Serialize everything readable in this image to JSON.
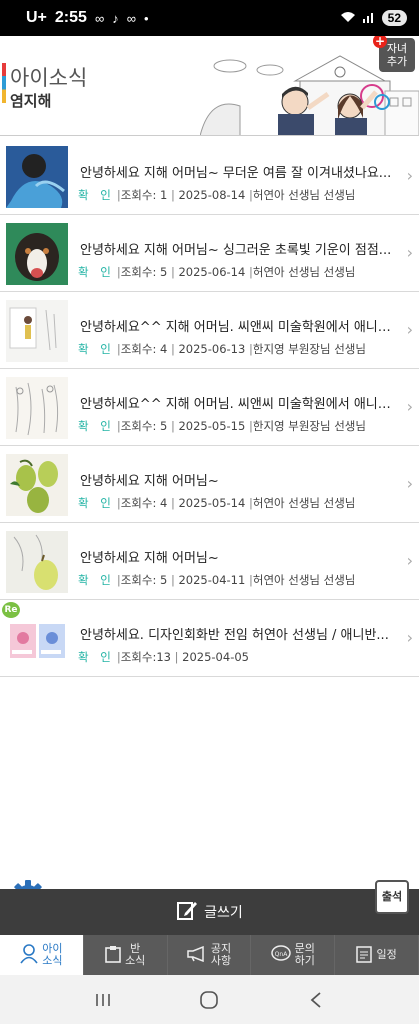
{
  "status_bar": {
    "carrier": "U+",
    "time": "2:55",
    "notification_icons": [
      "infinity-icon",
      "tiktok-icon",
      "infinity-icon",
      "dot-icon"
    ],
    "battery": "52"
  },
  "header": {
    "title": "아이소식",
    "student_name": "염지해",
    "add_child_label": "자녀\n추가"
  },
  "posts": [
    {
      "title": "안녕하세요 지해 어머님~ 무더운 여름 잘 이겨내셨나요...",
      "status": "확 인",
      "views": "조회수: 1",
      "date": "2025-08-14",
      "author": "허연아 선생님 선생님",
      "thumb": "blue-painting",
      "reply": false
    },
    {
      "title": "안녕하세요 지해 어머님~ 싱그러운 초록빛 기운이 점점...",
      "status": "확 인",
      "views": "조회수: 5",
      "date": "2025-06-14",
      "author": "허연아 선생님 선생님",
      "thumb": "dog-painting",
      "reply": false
    },
    {
      "title": "안녕하세요^^ 지해 어머님. 씨앤씨 미술학원에서 애니반...",
      "status": "확 인",
      "views": "조회수: 4",
      "date": "2025-06-13",
      "author": "한지영 부원장님 선생님",
      "thumb": "sketch-figure",
      "reply": false
    },
    {
      "title": "안녕하세요^^ 지해 어머님. 씨앤씨 미술학원에서 애니반...",
      "status": "확 인",
      "views": "조회수: 5",
      "date": "2025-05-15",
      "author": "한지영 부원장님 선생님",
      "thumb": "pencil-sketch",
      "reply": false
    },
    {
      "title": "안녕하세요 지해 어머님~",
      "status": "확 인",
      "views": "조회수: 4",
      "date": "2025-05-14",
      "author": "허연아 선생님 선생님",
      "thumb": "pears-painting",
      "reply": false
    },
    {
      "title": "안녕하세요 지해 어머님~",
      "status": "확 인",
      "views": "조회수: 5",
      "date": "2025-04-11",
      "author": "허연아 선생님 선생님",
      "thumb": "pear-sketch",
      "reply": false
    },
    {
      "title": "안녕하세요. 디자인회화반 전임 허연아 선생님 / 애니반...",
      "status": "확 인",
      "views": "조회수:13",
      "date": "2025-04-05",
      "author": "",
      "thumb": "poster-images",
      "reply": true,
      "reply_label": "Re"
    }
  ],
  "bottom": {
    "write_label": "글쓰기",
    "attendance_label": "출석",
    "tabs": [
      {
        "label": "아이\n소식",
        "icon": "person-icon",
        "active": true
      },
      {
        "label": "반\n소식",
        "icon": "clipboard-icon",
        "active": false
      },
      {
        "label": "공지\n사항",
        "icon": "megaphone-icon",
        "active": false
      },
      {
        "label": "문의\n하기",
        "icon": "qna-icon",
        "active": false
      },
      {
        "label": "일정",
        "icon": "calendar-icon",
        "active": false
      }
    ]
  },
  "colors": {
    "accent": "#2a79c5",
    "confirm": "#21b3a4",
    "tabbar": "#5a5a5a",
    "writebar": "#3d3d3d"
  }
}
